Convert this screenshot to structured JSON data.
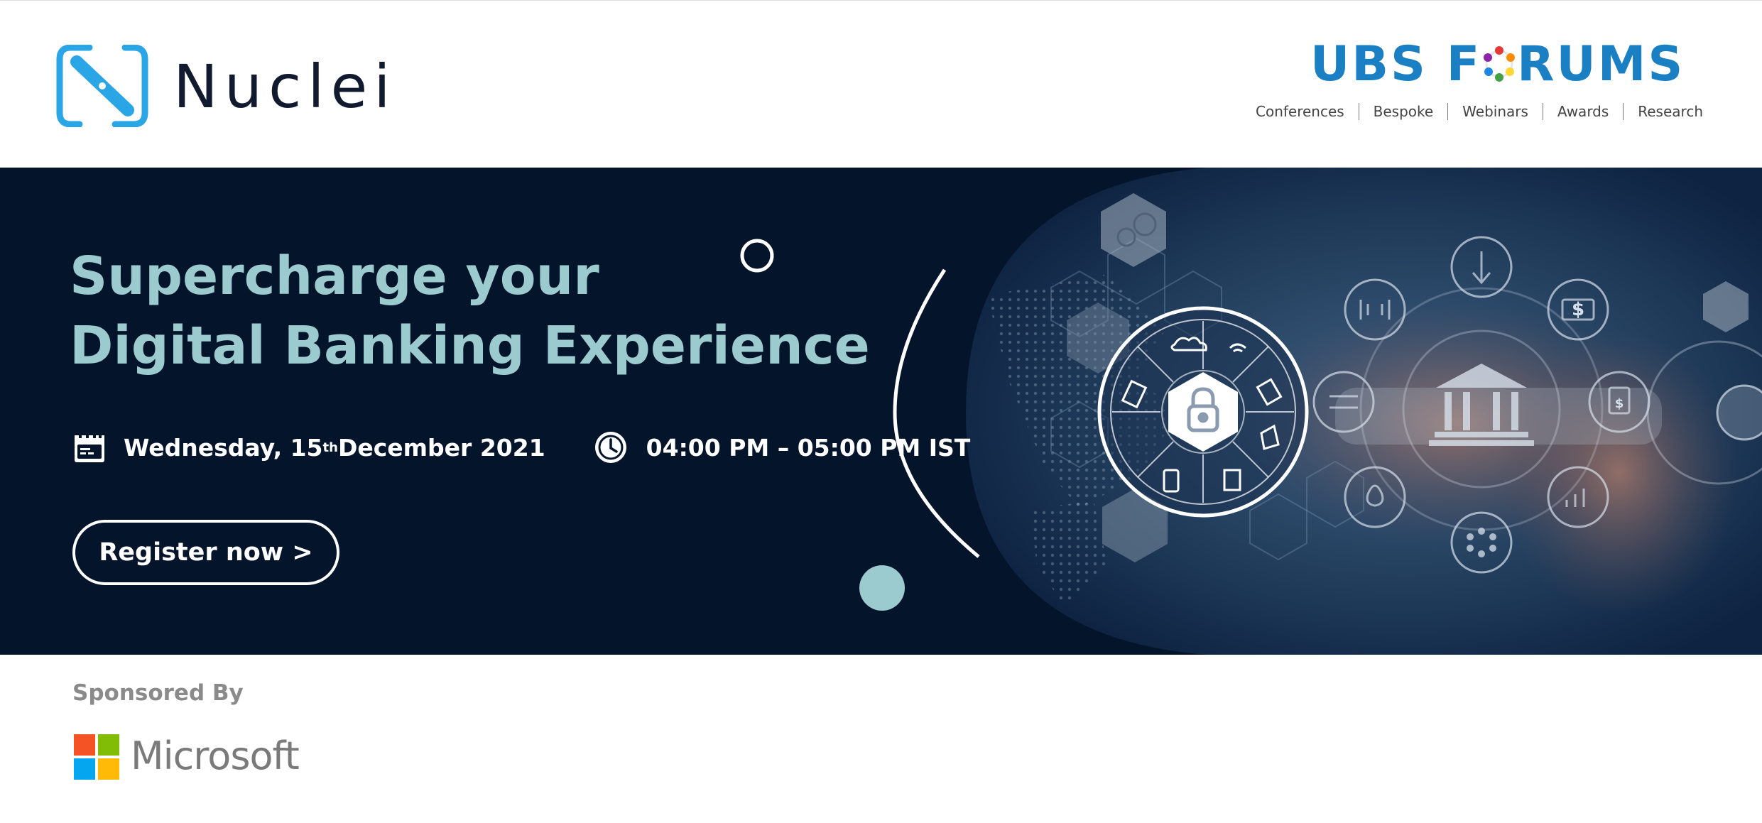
{
  "header": {
    "brand_name": "Nuclei",
    "organizer": {
      "title_part1": "UBS F",
      "title_part2": "RUMS",
      "nav": [
        "Conferences",
        "Bespoke",
        "Webinars",
        "Awards",
        "Research"
      ]
    }
  },
  "hero": {
    "headline_line1": "Supercharge your",
    "headline_line2": "Digital Banking Experience",
    "date_prefix": "Wednesday, 15",
    "date_suffix": "th",
    "date_rest": " December 2021",
    "time": "04:00 PM – 05:00 PM IST",
    "register_label": "Register now >"
  },
  "sponsor": {
    "label": "Sponsored By",
    "name": "Microsoft"
  },
  "colors": {
    "hero_background": "#04142b",
    "headline": "#9ccbcf",
    "ubs_blue": "#1b7fc4",
    "nuclei_blue": "#2aa5e6"
  },
  "icons": [
    "nuclei-logo-icon",
    "ubs-ring-icon",
    "calendar-icon",
    "clock-icon",
    "padlock-icon",
    "bank-icon",
    "microsoft-logo-icon"
  ]
}
